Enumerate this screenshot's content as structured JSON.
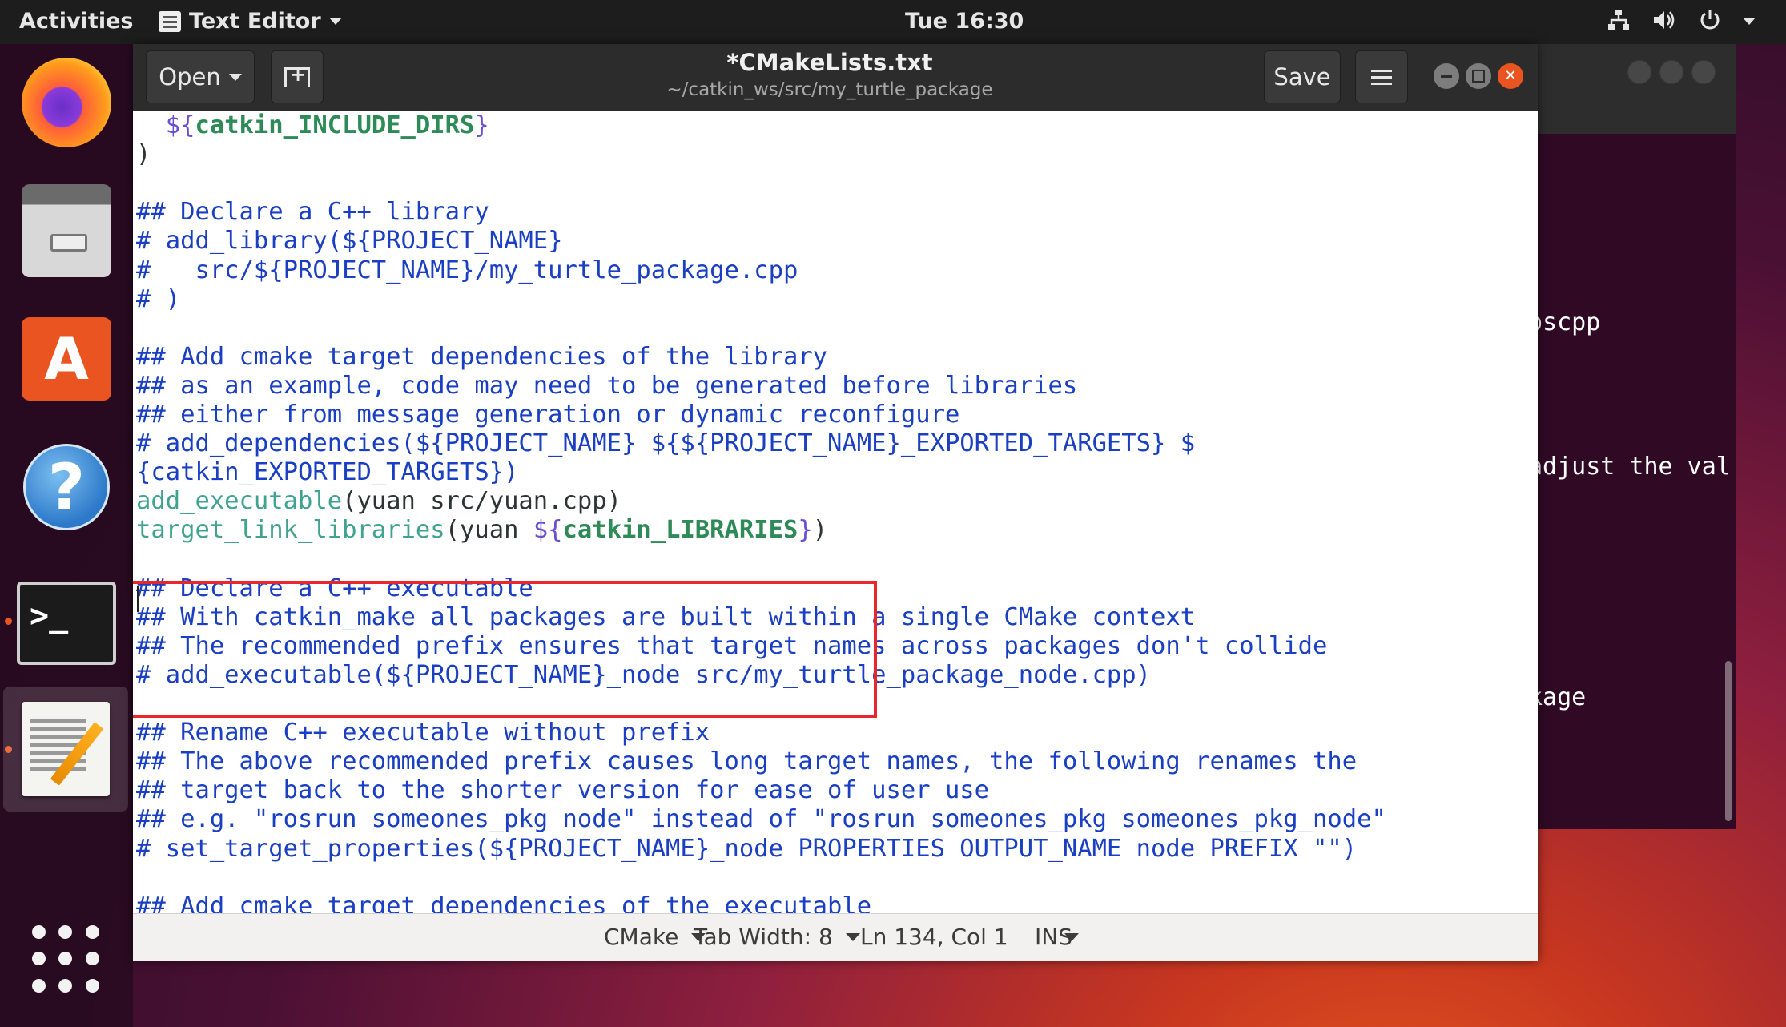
{
  "topbar": {
    "activities": "Activities",
    "app_name": "Text Editor",
    "clock": "Tue 16:30",
    "tray_icons": [
      "network-icon",
      "volume-icon",
      "power-icon"
    ]
  },
  "dock": {
    "items": [
      "firefox",
      "files",
      "software-center",
      "help",
      "terminal",
      "text-editor"
    ],
    "show_apps": "show-apps-grid"
  },
  "terminal_bg": {
    "lines": [
      "oscpp",
      "adjust the val",
      "kage"
    ]
  },
  "window": {
    "title": "*CMakeLists.txt",
    "subtitle": "~/catkin_ws/src/my_turtle_package",
    "open_label": "Open",
    "save_label": "Save"
  },
  "editor": {
    "lines": [
      [
        {
          "t": "  ",
          "c": ""
        },
        {
          "t": "${",
          "c": "var"
        },
        {
          "t": "catkin_INCLUDE_DIRS",
          "c": "varb"
        },
        {
          "t": "}",
          "c": "var"
        }
      ],
      [
        {
          "t": ")",
          "c": ""
        }
      ],
      [
        {
          "t": "",
          "c": ""
        }
      ],
      [
        {
          "t": "## Declare a C++ library",
          "c": "cm"
        }
      ],
      [
        {
          "t": "# add_library(${PROJECT_NAME}",
          "c": "cm"
        }
      ],
      [
        {
          "t": "#   src/${PROJECT_NAME}/my_turtle_package.cpp",
          "c": "cm"
        }
      ],
      [
        {
          "t": "# )",
          "c": "cm"
        }
      ],
      [
        {
          "t": "",
          "c": ""
        }
      ],
      [
        {
          "t": "## Add cmake target dependencies of the library",
          "c": "cm"
        }
      ],
      [
        {
          "t": "## as an example, code may need to be generated before libraries",
          "c": "cm"
        }
      ],
      [
        {
          "t": "## either from message generation or dynamic reconfigure",
          "c": "cm"
        }
      ],
      [
        {
          "t": "# add_dependencies(${PROJECT_NAME} ${${PROJECT_NAME}_EXPORTED_TARGETS} $",
          "c": "cm"
        }
      ],
      [
        {
          "t": "{catkin_EXPORTED_TARGETS})",
          "c": "cm"
        }
      ],
      [
        {
          "t": "add_executable",
          "c": "kw"
        },
        {
          "t": "(yuan src/yuan.cpp)",
          "c": ""
        }
      ],
      [
        {
          "t": "target_link_libraries",
          "c": "kw"
        },
        {
          "t": "(yuan ",
          "c": ""
        },
        {
          "t": "${",
          "c": "var"
        },
        {
          "t": "catkin_LIBRARIES",
          "c": "varb"
        },
        {
          "t": "}",
          "c": "var"
        },
        {
          "t": ")",
          "c": ""
        }
      ],
      [
        {
          "t": "",
          "c": ""
        }
      ],
      [
        {
          "t": "## Declare a C++ executable",
          "c": "cm"
        }
      ],
      [
        {
          "t": "## With catkin_make all packages are built within a single CMake context",
          "c": "cm"
        }
      ],
      [
        {
          "t": "## The recommended prefix ensures that target names across packages don't collide",
          "c": "cm"
        }
      ],
      [
        {
          "t": "# add_executable(${PROJECT_NAME}_node src/my_turtle_package_node.cpp)",
          "c": "cm"
        }
      ],
      [
        {
          "t": "",
          "c": ""
        }
      ],
      [
        {
          "t": "## Rename C++ executable without prefix",
          "c": "cm"
        }
      ],
      [
        {
          "t": "## The above recommended prefix causes long target names, the following renames the",
          "c": "cm"
        }
      ],
      [
        {
          "t": "## target back to the shorter version for ease of user use",
          "c": "cm"
        }
      ],
      [
        {
          "t": "## e.g. \"rosrun someones_pkg node\" instead of \"rosrun someones_pkg someones_pkg_node\"",
          "c": "cm"
        }
      ],
      [
        {
          "t": "# set_target_properties(${PROJECT_NAME}_node PROPERTIES OUTPUT_NAME node PREFIX \"\")",
          "c": "cm"
        }
      ],
      [
        {
          "t": "",
          "c": ""
        }
      ],
      [
        {
          "t": "## Add cmake target dependencies of the executable",
          "c": "cm"
        }
      ]
    ],
    "colors": {
      "comment": "#1a3fc2",
      "command": "#3fa38f",
      "variable": "#6a4fd0",
      "highlight_box": "#e8262b"
    }
  },
  "statusbar": {
    "language": "CMake",
    "tab_width": "Tab Width: 8",
    "position": "Ln 134, Col 1",
    "mode": "INS"
  }
}
